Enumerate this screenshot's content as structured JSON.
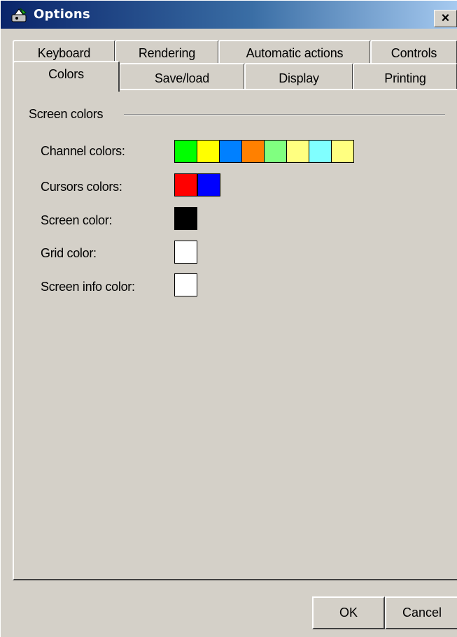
{
  "window": {
    "title": "Options",
    "icon": "options-app-icon",
    "close_glyph": "✕"
  },
  "tabs": {
    "row1": [
      {
        "id": "keyboard",
        "label": "Keyboard"
      },
      {
        "id": "rendering",
        "label": "Rendering"
      },
      {
        "id": "automatic-actions",
        "label": "Automatic actions"
      },
      {
        "id": "controls",
        "label": "Controls"
      }
    ],
    "row2": [
      {
        "id": "colors",
        "label": "Colors",
        "active": true
      },
      {
        "id": "save-load",
        "label": "Save/load"
      },
      {
        "id": "display",
        "label": "Display"
      },
      {
        "id": "printing",
        "label": "Printing"
      }
    ]
  },
  "group": {
    "label": "Screen colors"
  },
  "rows": [
    {
      "id": "channel-colors",
      "label": "Channel colors:",
      "colors": [
        "#00ff00",
        "#ffff00",
        "#0080ff",
        "#ff8000",
        "#80ff80",
        "#ffff80",
        "#80ffff",
        "#ffff80"
      ]
    },
    {
      "id": "cursors-colors",
      "label": "Cursors colors:",
      "colors": [
        "#ff0000",
        "#0000ff"
      ]
    },
    {
      "id": "screen-color",
      "label": "Screen color:",
      "colors": [
        "#000000"
      ]
    },
    {
      "id": "grid-color",
      "label": "Grid color:",
      "colors": [
        "#ffffff"
      ]
    },
    {
      "id": "screen-info-color",
      "label": "Screen info color:",
      "colors": [
        "#ffffff"
      ]
    }
  ],
  "buttons": {
    "ok": "OK",
    "cancel": "Cancel"
  }
}
